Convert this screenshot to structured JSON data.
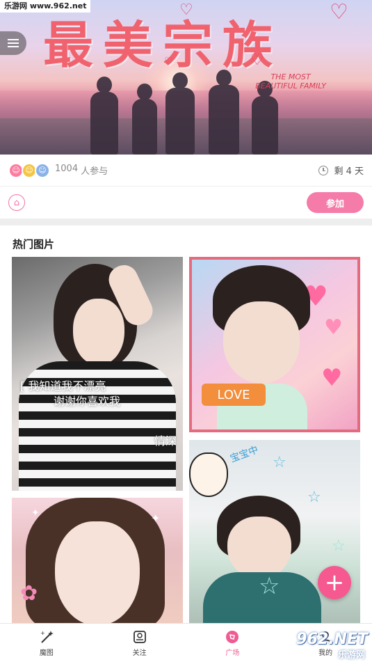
{
  "watermark": "乐游网 www.962.net",
  "banner": {
    "title": "最美宗族",
    "subtitle_line1": "THE MOST",
    "subtitle_line2": "BEAUTIFUL FAMILY"
  },
  "info": {
    "participants_count": "1004",
    "participants_label": "人参与",
    "days_left": "剩 4 天"
  },
  "join_button": "参加",
  "section_title": "热门图片",
  "photos": [
    {
      "caption1": "[ 我知道我不漂亮",
      "caption2": "谢谢你喜欢我",
      "caption3": "情深"
    },
    {
      "tag": "LOVE"
    },
    {},
    {
      "sticker": "宝宝中"
    }
  ],
  "fab_label": "+",
  "nav": [
    {
      "label": "魔图",
      "icon": "magic-wand-icon",
      "active": false
    },
    {
      "label": "关注",
      "icon": "follow-icon",
      "active": false
    },
    {
      "label": "广场",
      "icon": "square-icon",
      "active": true
    },
    {
      "label": "我的",
      "icon": "profile-icon",
      "active": false
    }
  ],
  "corner_mark": "962.NET",
  "corner_mark_sub": "乐游网",
  "colors": {
    "accent": "#f57ca9",
    "fab": "#f5598f",
    "active_nav": "#f05b93"
  }
}
